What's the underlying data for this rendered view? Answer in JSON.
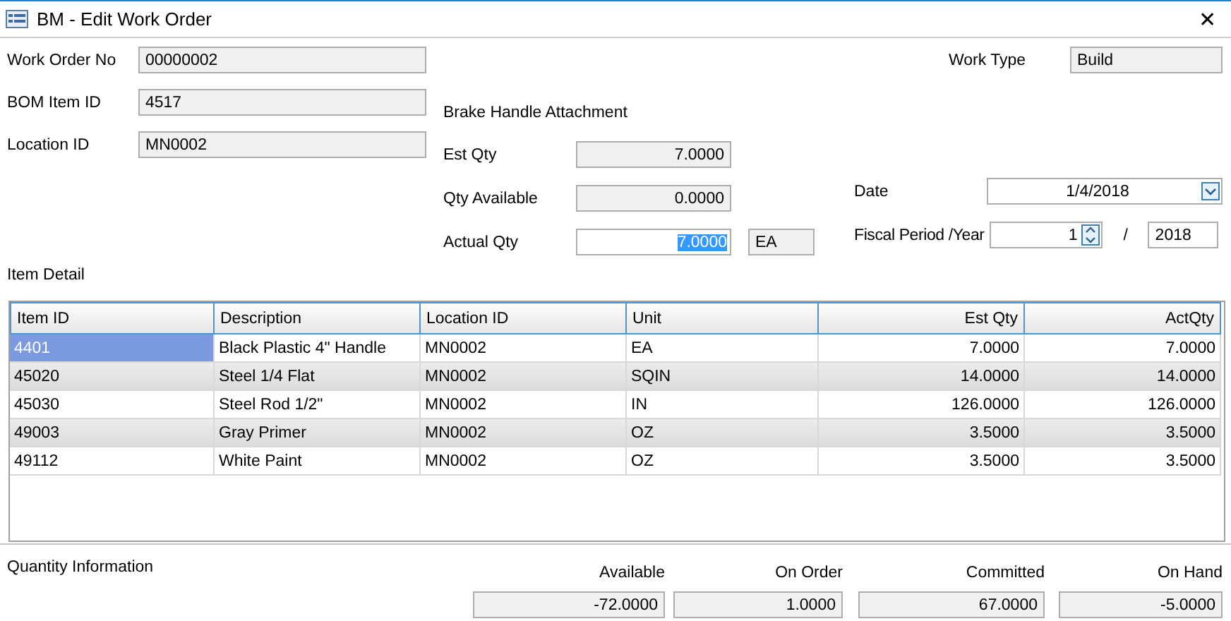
{
  "window": {
    "title": "BM - Edit Work Order",
    "close": "✕"
  },
  "work_order_no": {
    "label": "Work Order No",
    "value": "00000002"
  },
  "bom_item_id": {
    "label": "BOM Item ID",
    "value": "4517"
  },
  "location_id": {
    "label": "Location ID",
    "value": "MN0002"
  },
  "bom_description": "Brake Handle Attachment",
  "work_type": {
    "label": "Work Type",
    "value": "Build"
  },
  "est_qty": {
    "label": "Est Qty",
    "value": "7.0000"
  },
  "qty_available": {
    "label": "Qty Available",
    "value": "0.0000"
  },
  "actual_qty": {
    "label": "Actual Qty",
    "value": "7.0000",
    "selected": true,
    "unit": "EA"
  },
  "date": {
    "label": "Date",
    "value": "1/4/2018"
  },
  "fiscal": {
    "label": "Fiscal Period /Year",
    "period": "1",
    "separator": "/",
    "year": "2018"
  },
  "item_detail": {
    "title": "Item Detail",
    "columns": [
      {
        "label": "Item ID",
        "kind": "text"
      },
      {
        "label": "Description",
        "kind": "text"
      },
      {
        "label": "Location ID",
        "kind": "text"
      },
      {
        "label": "Unit",
        "kind": "text"
      },
      {
        "label": "Est Qty",
        "kind": "number"
      },
      {
        "label": "ActQty",
        "kind": "number"
      }
    ],
    "rows": [
      {
        "selected": true,
        "cells": [
          "4401",
          "Black Plastic 4\" Handle",
          "MN0002",
          "EA",
          "7.0000",
          "7.0000"
        ]
      },
      {
        "selected": false,
        "cells": [
          "45020",
          "Steel 1/4 Flat",
          "MN0002",
          "SQIN",
          "14.0000",
          "14.0000"
        ]
      },
      {
        "selected": false,
        "cells": [
          "45030",
          "Steel Rod 1/2\"",
          "MN0002",
          "IN",
          "126.0000",
          "126.0000"
        ]
      },
      {
        "selected": false,
        "cells": [
          "49003",
          "Gray Primer",
          "MN0002",
          "OZ",
          "3.5000",
          "3.5000"
        ]
      },
      {
        "selected": false,
        "cells": [
          "49112",
          "White Paint",
          "MN0002",
          "OZ",
          "3.5000",
          "3.5000"
        ]
      }
    ]
  },
  "quantity_information": {
    "title": "Quantity Information",
    "items": [
      {
        "label": "Available",
        "value": "-72.0000"
      },
      {
        "label": "On Order",
        "value": "1.0000"
      },
      {
        "label": "Committed",
        "value": "67.0000"
      },
      {
        "label": "On Hand",
        "value": "-5.0000"
      }
    ]
  }
}
